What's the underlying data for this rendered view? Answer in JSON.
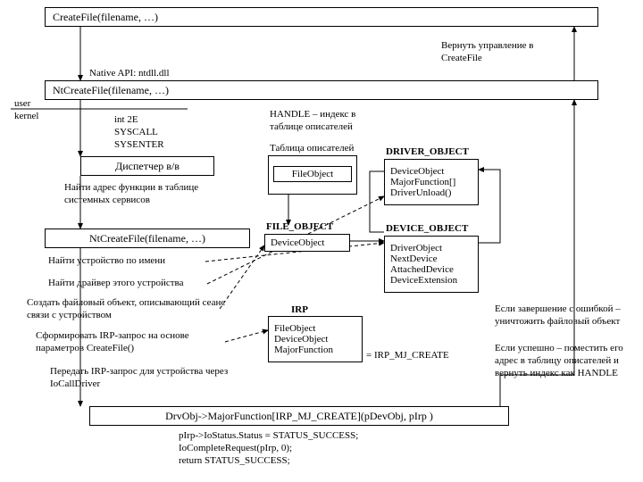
{
  "boxes": {
    "createfile": "CreateFile(filename, …)",
    "ntcreate1": "NtCreateFile(filename, …)",
    "dispatcher": "Диспетчер в/в",
    "ntcreate2": "NtCreateFile(filename, …)",
    "drvcall": "DrvObj->MajorFunction[IRP_MJ_CREATE](pDevObj, pIrp )"
  },
  "notes": {
    "return_top": "Вернуть управление в CreateFile",
    "native_api": "Native API: ntdll.dll",
    "user": "user",
    "kernel": "kernel",
    "int2e": "int 2E\nSYSCALL\nSYSENTER",
    "find_syssvc": "Найти адрес функции в таблице системных сервисов",
    "handle_note": "HANDLE – индекс в таблице описателей",
    "htable_caption": "Таблица описателей",
    "fileobject_cell": "FileObject",
    "drv_hdr": "DRIVER_OBJECT",
    "drv_body": "DeviceObject\nMajorFunction[]\nDriverUnload()",
    "file_hdr": "FILE_OBJECT",
    "file_body": "DeviceObject",
    "dev_hdr": "DEVICE_OBJECT",
    "dev_body": "DriverObject\nNextDevice\nAttachedDevice\nDeviceExtension",
    "irp_hdr": "IRP",
    "irp_body": "FileObject\nDeviceObject\nMajorFunction",
    "irp_mj": "= IRP_MJ_CREATE",
    "step_device": "Найти  устройство по имени",
    "step_driver": "Найти  драйвер этого устройства",
    "step_fileobj": "Создать файловый объект, описывающий сеанс связи с устройством",
    "step_irp": "Сформировать IRP-запрос на основе параметров CreateFile()",
    "step_iocall": "Передать IRP-запрос для устройства через IoCallDriver",
    "right_text1": "Если завершение с ошибкой – уничтожить файловый объект",
    "right_text2": "Если успешно – поместить его адрес в таблицу описателей и вернуть индекс как HANDLE",
    "bottom_code": "pIrp->IoStatus.Status = STATUS_SUCCESS;\nIoCompleteRequest(pIrp, 0);\nreturn STATUS_SUCCESS;"
  }
}
